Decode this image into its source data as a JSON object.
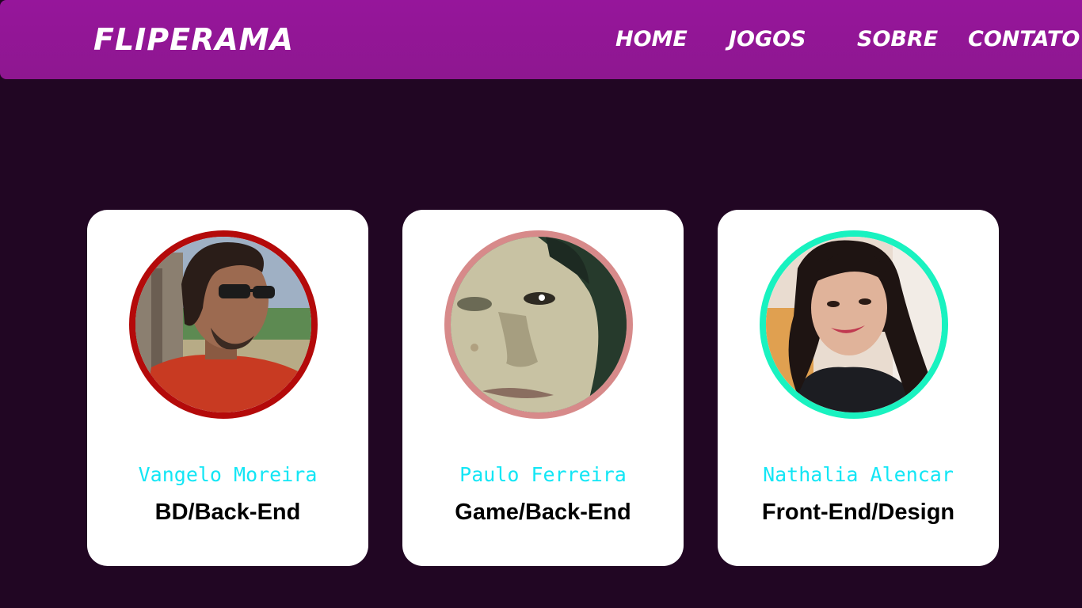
{
  "header": {
    "brand": "FLIPERAMA",
    "nav": [
      {
        "label": "HOME"
      },
      {
        "label": "JOGOS"
      },
      {
        "label": "SOBRE"
      },
      {
        "label": "CONTATO"
      }
    ]
  },
  "team": [
    {
      "name": "Vangelo Moreira",
      "role": "BD/Back-End",
      "ring_color": "#b40a0a"
    },
    {
      "name": "Paulo Ferreira",
      "role": "Game/Back-End",
      "ring_color": "#d78a8a"
    },
    {
      "name": "Nathalia Alencar",
      "role": "Front-End/Design",
      "ring_color": "#19f2c0"
    }
  ],
  "colors": {
    "background": "#210623",
    "header": "#96169b",
    "name_text": "#13e6f5"
  }
}
